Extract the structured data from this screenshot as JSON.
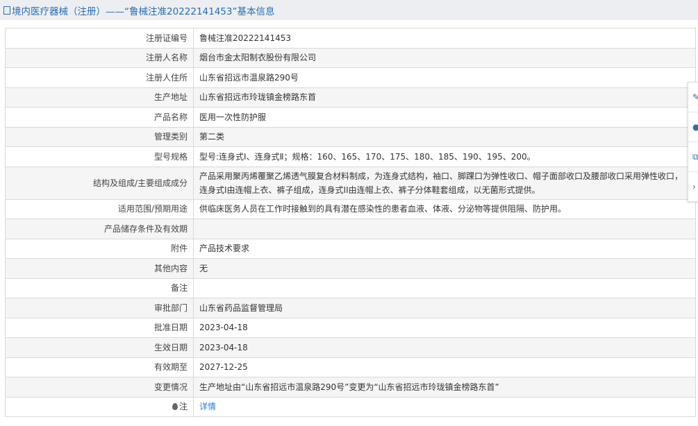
{
  "title": "境内医疗器械（注册）——“鲁械注准20222141453”基本信息",
  "rows": [
    {
      "label": "注册证编号",
      "value": "鲁械注准20222141453"
    },
    {
      "label": "注册人名称",
      "value": "烟台市金太阳制衣股份有限公司"
    },
    {
      "label": "注册人住所",
      "value": "山东省招远市温泉路290号"
    },
    {
      "label": "生产地址",
      "value": "山东省招远市玲珑镇金榜路东首"
    },
    {
      "label": "产品名称",
      "value": "医用一次性防护服"
    },
    {
      "label": "管理类别",
      "value": "第二类"
    },
    {
      "label": "型号规格",
      "value": "型号:连身式Ⅰ、连身式Ⅱ；规格：160、165、170、175、180、185、190、195、200。"
    },
    {
      "label": "结构及组成/主要组成成分",
      "value": "产品采用聚丙烯覆聚乙烯透气膜复合材料制成，为连身式结构，袖口、脚踝口为弹性收口、帽子面部收口及腰部收口采用弹性收口，连身式I由连帽上衣、裤子组成，连身式II由连帽上衣、裤子分体鞋套组成，以无菌形式提供。"
    },
    {
      "label": "适用范围/预期用途",
      "value": "供临床医务人员在工作时接触到的具有潜在感染性的患者血液、体液、分泌物等提供阻隔、防护用。"
    },
    {
      "label": "产品储存条件及有效期",
      "value": ""
    },
    {
      "label": "附件",
      "value": "产品技术要求"
    },
    {
      "label": "其他内容",
      "value": "无"
    },
    {
      "label": "备注",
      "value": ""
    },
    {
      "label": "审批部门",
      "value": "山东省药品监督管理局"
    },
    {
      "label": "批准日期",
      "value": "2023-04-18"
    },
    {
      "label": "生效日期",
      "value": "2023-04-18"
    },
    {
      "label": "有效期至",
      "value": "2027-12-25"
    },
    {
      "label": "变更情况",
      "value": "生产地址由“山东省招远市温泉路290号”变更为“山东省招远市玲珑镇金榜路东首”"
    }
  ],
  "note": {
    "label": "注",
    "link": "详情"
  }
}
